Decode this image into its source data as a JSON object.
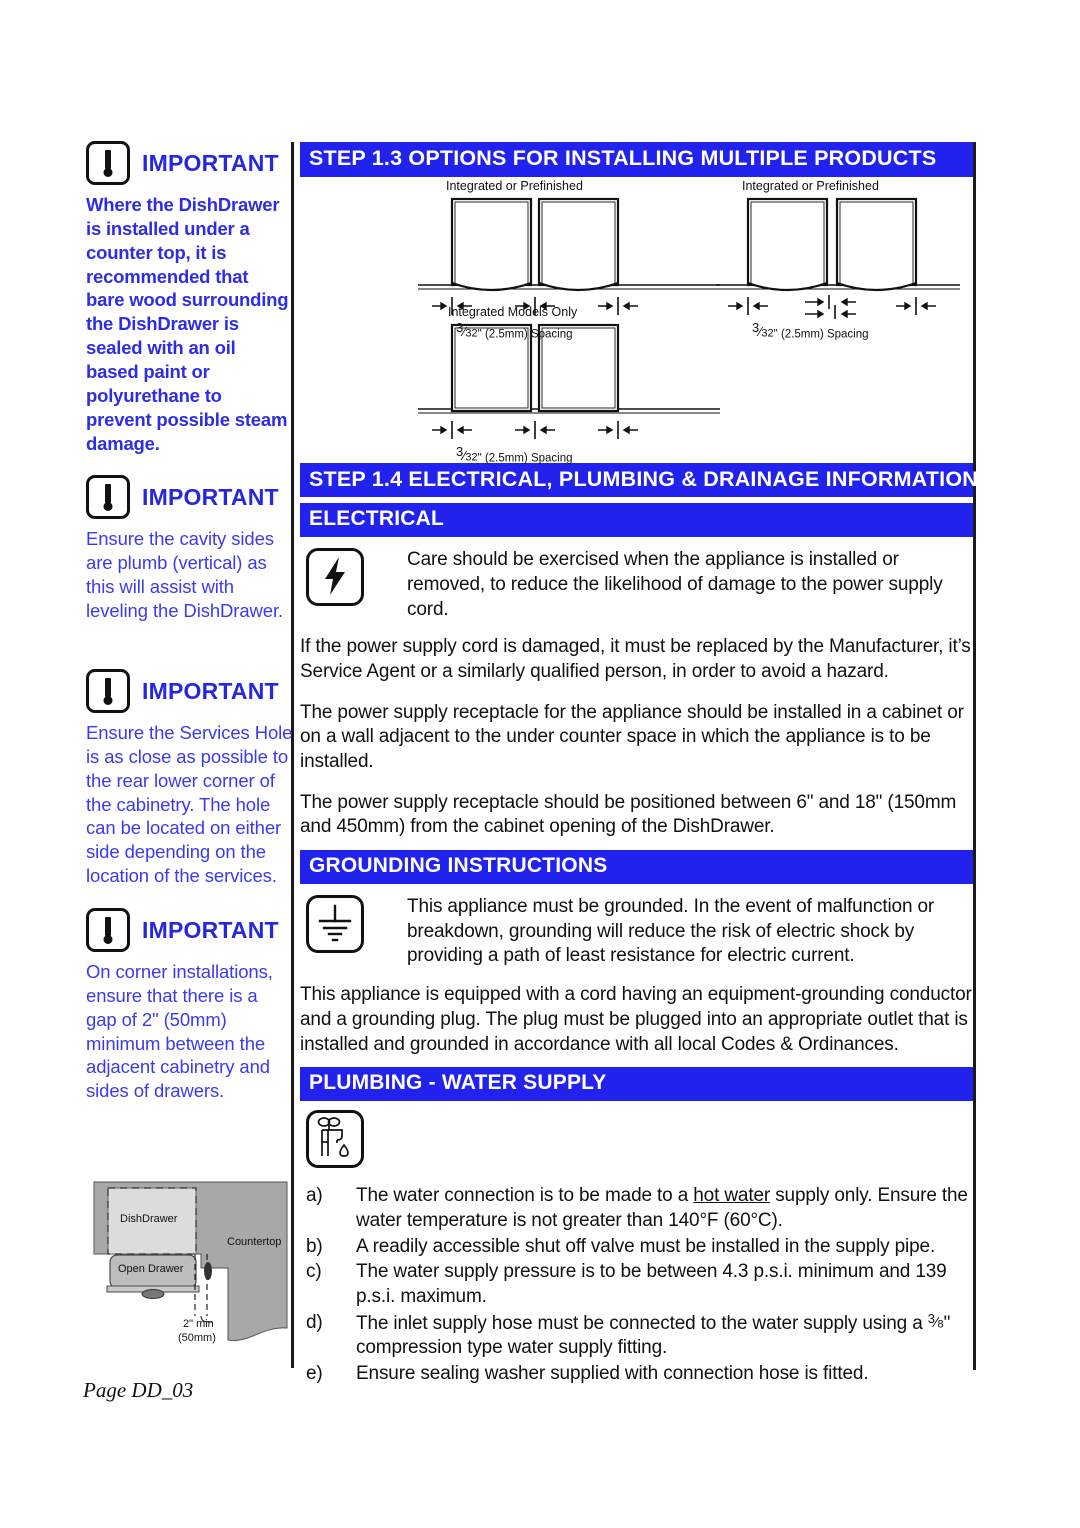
{
  "document": {
    "page_label": "Page DD_03"
  },
  "important_notices": [
    {
      "icon": "exclamation-icon",
      "label": "IMPORTANT",
      "body": "Where the DishDrawer is installed under a counter top, it is recommended that bare wood surrounding the DishDrawer is sealed with an oil based paint or polyurethane to prevent possible steam damage.",
      "emphasis": "bold"
    },
    {
      "icon": "exclamation-icon",
      "label": "IMPORTANT",
      "body": "Ensure the cavity sides are plumb (vertical) as this will assist with leveling the DishDrawer.",
      "emphasis": "regular"
    },
    {
      "icon": "exclamation-icon",
      "label": "IMPORTANT",
      "body": "Ensure the Services Hole is as close as possible to the rear lower corner of the cabinetry.  The hole can be located on either side depending on the location of the services.",
      "emphasis": "regular"
    },
    {
      "icon": "exclamation-icon",
      "label": "IMPORTANT",
      "body": "On corner installations, ensure that there is a gap of 2\" (50mm) minimum between the adjacent cabinetry and sides of drawers.",
      "emphasis": "regular"
    }
  ],
  "corner_diagram": {
    "dishdrawer_label": "DishDrawer",
    "open_drawer_label": "Open Drawer",
    "countertop_label": "Countertop",
    "gap_line1": "2\" min",
    "gap_line2": "(50mm)"
  },
  "step_1_3": {
    "heading": "STEP  1.3  OPTIONS FOR INSTALLING MULTIPLE PRODUCTS",
    "diagrams": [
      {
        "caption": "Integrated or Prefinished",
        "spacing_numerator": "3",
        "spacing_denominator": "32",
        "spacing_unit": "\"",
        "spacing_metric": "(2.5mm) Spacing"
      },
      {
        "caption": "Integrated or Prefinished",
        "spacing_numerator": "3",
        "spacing_denominator": "32",
        "spacing_unit": "\"",
        "spacing_metric": "(2.5mm) Spacing"
      },
      {
        "caption": "Integrated Models Only",
        "spacing_numerator": "3",
        "spacing_denominator": "32",
        "spacing_unit": "\"",
        "spacing_metric": "(2.5mm) Spacing"
      }
    ]
  },
  "step_1_4": {
    "heading": "STEP  1.4  ELECTRICAL, PLUMBING & DRAINAGE INFORMATION",
    "electrical": {
      "heading": "ELECTRICAL",
      "icon": "lightning-bolt-icon",
      "icon_paragraph": "Care should be exercised when the appliance is installed or removed, to reduce the likelihood of damage to the power supply cord.",
      "paragraphs": [
        "If the power supply cord is damaged, it must be replaced by the Manufacturer, it’s Service Agent or a similarly qualified person, in order to avoid a hazard.",
        "The power supply receptacle for the appliance should be installed in a cabinet or on a wall adjacent to the under counter space in which the appliance is to be installed.",
        "The power supply receptacle should be positioned between 6\" and 18\" (150mm and 450mm) from the cabinet opening of the DishDrawer."
      ]
    },
    "grounding": {
      "heading": "GROUNDING  INSTRUCTIONS",
      "icon": "earth-ground-icon",
      "icon_paragraph": "This appliance must be grounded.  In the event of malfunction or breakdown, grounding will reduce the risk of electric shock by providing a path of least resistance for electric current.",
      "paragraphs": [
        "This appliance is equipped with a cord having an equipment-grounding conductor and a grounding plug.  The plug must be plugged into an appropriate outlet that is installed and grounded in accordance with all local Codes & Ordinances."
      ]
    },
    "plumbing": {
      "heading": "PLUMBING  -  WATER  SUPPLY",
      "icon": "faucet-icon",
      "items": [
        {
          "marker": "a)",
          "text_before": "The water connection is to be made to a ",
          "underlined": "hot water",
          "text_after": " supply only.  Ensure the water temperature is not greater than 140°F (60°C)."
        },
        {
          "marker": "b)",
          "text": "A readily accessible shut off valve must be installed in the supply pipe."
        },
        {
          "marker": "c)",
          "text": "The water supply pressure is to be between 4.3 p.s.i. minimum and 139 p.s.i. maximum."
        },
        {
          "marker": "d)",
          "text_before": "The inlet supply hose must be connected to the water supply using a ",
          "fraction_numerator": "3",
          "fraction_denominator": "8",
          "text_after": "\" compression type water supply fitting."
        },
        {
          "marker": "e)",
          "text": "Ensure sealing washer supplied with connection hose is fitted."
        }
      ]
    }
  },
  "colors": {
    "header_blue": "#2222ee",
    "notice_blue": "#3a3af0",
    "ink": "#111111"
  }
}
